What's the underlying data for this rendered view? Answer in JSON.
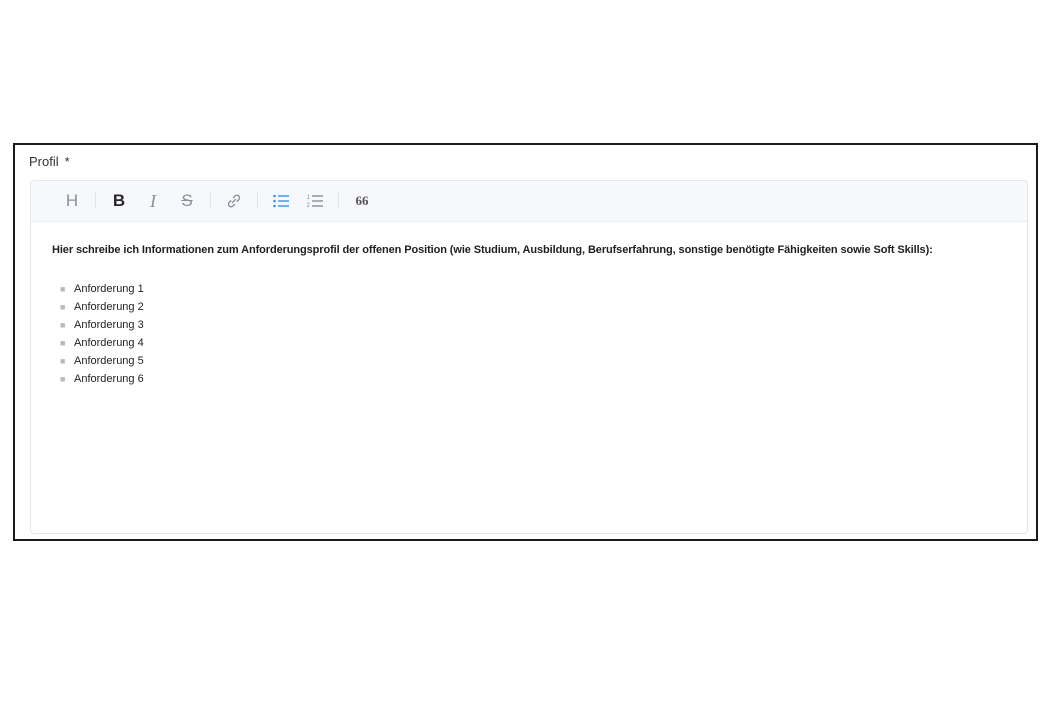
{
  "field": {
    "label": "Profil",
    "required_mark": "*"
  },
  "toolbar": {
    "heading": "H",
    "bold": "B",
    "italic": "I",
    "strike": "S",
    "quote": "66",
    "active_color": "#3d8ef0",
    "icons": [
      "heading-icon",
      "bold-icon",
      "italic-icon",
      "strikethrough-icon",
      "link-icon",
      "bullet-list-icon",
      "numbered-list-icon",
      "quote-icon"
    ]
  },
  "content": {
    "intro": "Hier schreibe ich Informationen zum Anforderungsprofil der offenen Position (wie Studium, Ausbildung, Berufserfahrung, sonstige benötigte Fähigkeiten sowie Soft Skills):",
    "items": [
      "Anforderung 1",
      "Anforderung 2",
      "Anforderung 3",
      "Anforderung 4",
      "Anforderung 5",
      "Anforderung 6"
    ]
  }
}
